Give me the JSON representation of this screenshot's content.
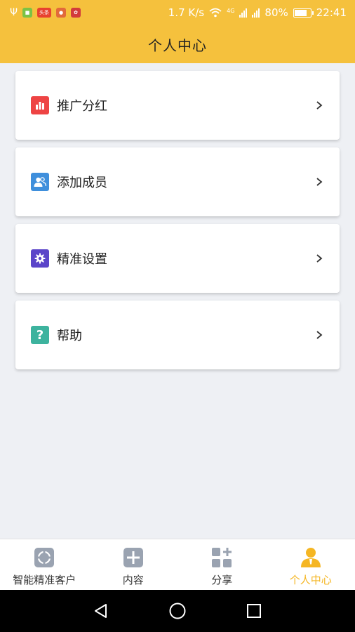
{
  "status_bar": {
    "net_speed": "1.7 K/s",
    "network_type": "4G",
    "battery": "80%",
    "time": "22:41",
    "notification_icons": [
      "usb-icon",
      "app-notif-icon",
      "toutiao-icon",
      "app-notif-icon",
      "huawei-icon"
    ],
    "toutiao_label": "头条"
  },
  "header": {
    "title": "个人中心"
  },
  "menu": [
    {
      "label": "推广分红",
      "icon": "bar-chart-icon",
      "color": "#ee4444"
    },
    {
      "label": "添加成员",
      "icon": "add-member-icon",
      "color": "#3f8fdc"
    },
    {
      "label": "精准设置",
      "icon": "gear-icon",
      "color": "#5b45c9"
    },
    {
      "label": "帮助",
      "icon": "help-icon",
      "color": "#3db39e",
      "glyph": "?"
    }
  ],
  "bottom_nav": {
    "items": [
      {
        "label": "智能精准客户",
        "icon": "target-icon"
      },
      {
        "label": "内容",
        "icon": "plus-box-icon"
      },
      {
        "label": "分享",
        "icon": "grid-plus-icon"
      },
      {
        "label": "个人中心",
        "icon": "person-icon"
      }
    ],
    "active_index": 3
  },
  "colors": {
    "primary": "#f5c13d",
    "active_tab": "#f5b623",
    "inactive_icon": "#9aa3b1",
    "background": "#eef0f4"
  },
  "system_nav": [
    "back-icon",
    "home-icon",
    "recents-icon"
  ]
}
